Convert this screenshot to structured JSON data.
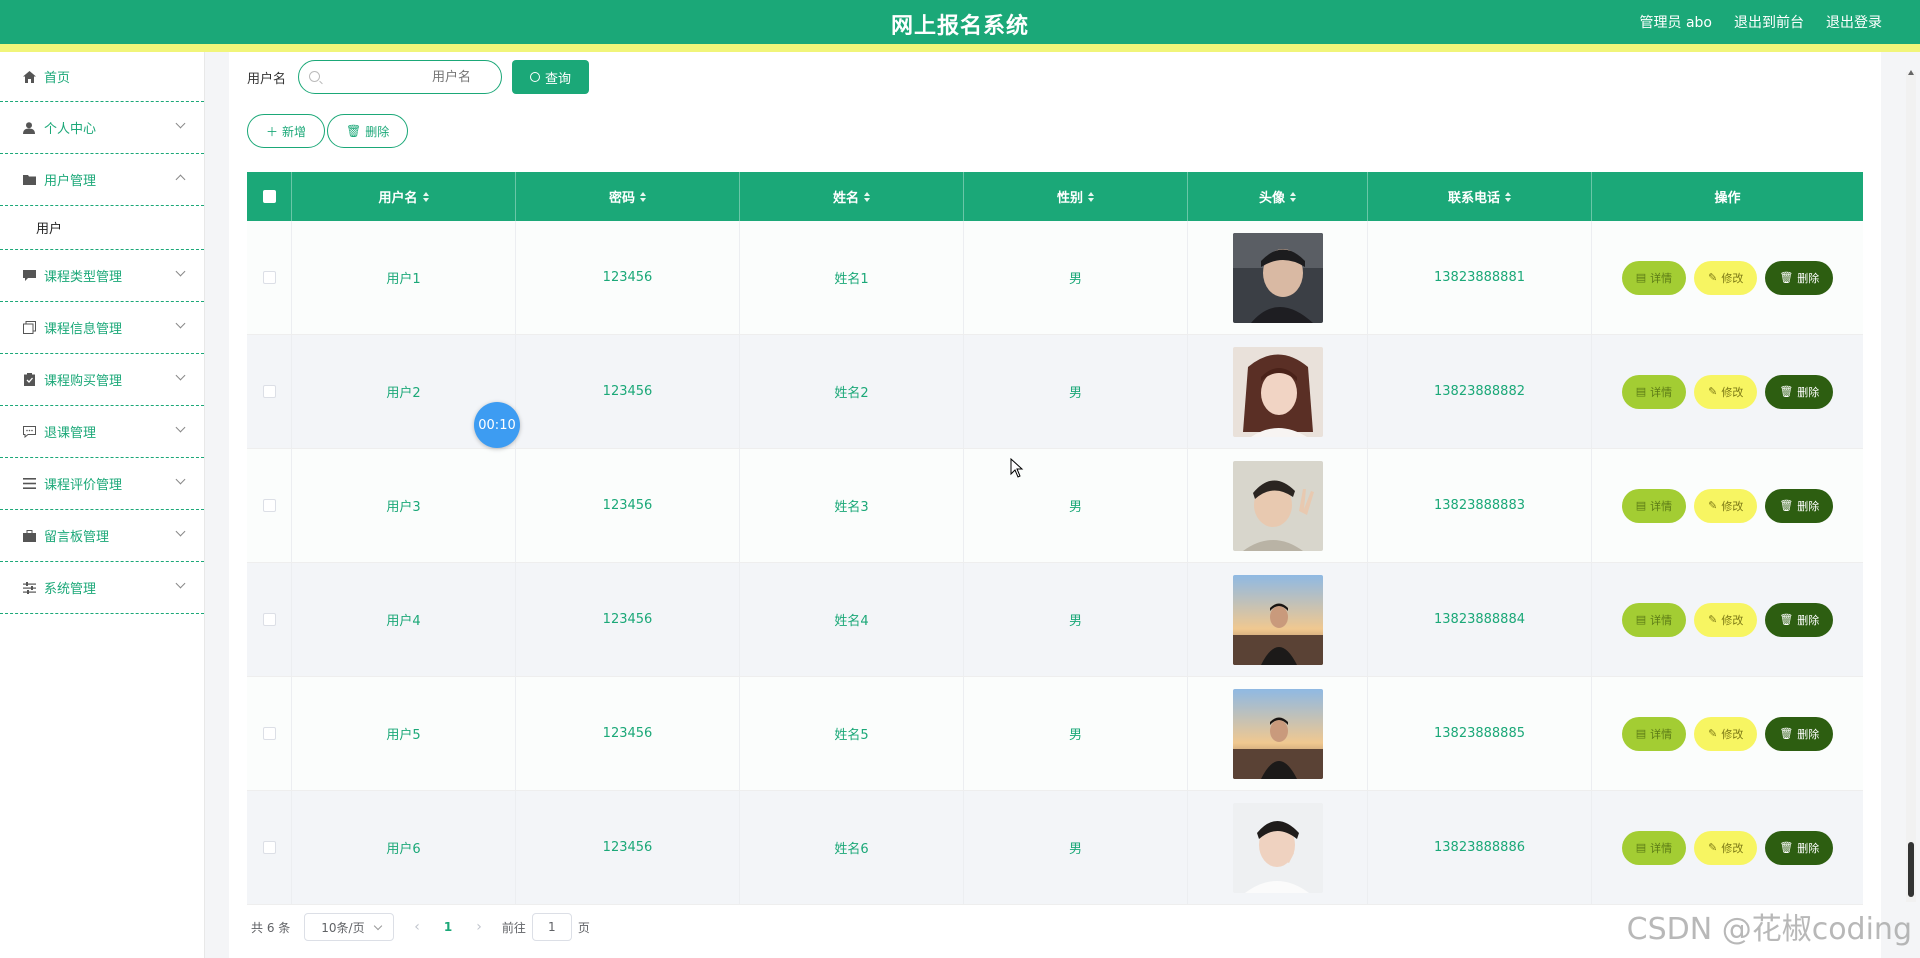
{
  "header": {
    "title": "网上报名系统",
    "admin": "管理员 abo",
    "to_front": "退出到前台",
    "logout": "退出登录"
  },
  "sidebar": {
    "items": [
      {
        "label": "首页",
        "icon": "home-icon",
        "expandable": false
      },
      {
        "label": "个人中心",
        "icon": "user-icon",
        "expandable": true
      },
      {
        "label": "用户管理",
        "icon": "folder-icon",
        "expandable": true,
        "expanded": true
      },
      {
        "label": "课程类型管理",
        "icon": "chat-icon",
        "expandable": true
      },
      {
        "label": "课程信息管理",
        "icon": "copy-icon",
        "expandable": true
      },
      {
        "label": "课程购买管理",
        "icon": "clipboard-icon",
        "expandable": true
      },
      {
        "label": "退课管理",
        "icon": "message-icon",
        "expandable": true
      },
      {
        "label": "课程评价管理",
        "icon": "list-icon",
        "expandable": true
      },
      {
        "label": "留言板管理",
        "icon": "briefcase-icon",
        "expandable": true
      },
      {
        "label": "系统管理",
        "icon": "sliders-icon",
        "expandable": true
      }
    ],
    "sub_item": "用户"
  },
  "search": {
    "label": "用户名",
    "placeholder": "用户名",
    "button": "查询"
  },
  "actions": {
    "add": "新增",
    "delete": "删除"
  },
  "table": {
    "columns": [
      "用户名",
      "密码",
      "姓名",
      "性别",
      "头像",
      "联系电话",
      "操作"
    ],
    "rows": [
      {
        "username": "用户1",
        "password": "123456",
        "name": "姓名1",
        "gender": "男",
        "phone": "13823888881"
      },
      {
        "username": "用户2",
        "password": "123456",
        "name": "姓名2",
        "gender": "男",
        "phone": "13823888882"
      },
      {
        "username": "用户3",
        "password": "123456",
        "name": "姓名3",
        "gender": "男",
        "phone": "13823888883"
      },
      {
        "username": "用户4",
        "password": "123456",
        "name": "姓名4",
        "gender": "男",
        "phone": "13823888884"
      },
      {
        "username": "用户5",
        "password": "123456",
        "name": "姓名5",
        "gender": "男",
        "phone": "13823888885"
      },
      {
        "username": "用户6",
        "password": "123456",
        "name": "姓名6",
        "gender": "男",
        "phone": "13823888886"
      }
    ],
    "op_detail": "详情",
    "op_edit": "修改",
    "op_delete": "删除"
  },
  "pagination": {
    "total": "共 6 条",
    "page_size": "10条/页",
    "current": "1",
    "goto_prefix": "前往",
    "goto_value": "1",
    "goto_suffix": "页"
  },
  "overlay": {
    "timer": "00:10",
    "watermark": "CSDN @花椒coding"
  },
  "colors": {
    "primary": "#1ba878",
    "stripe": "#f1f57a",
    "detail": "#a3cd33",
    "edit": "#f7f562",
    "delete": "#2d5e11"
  }
}
